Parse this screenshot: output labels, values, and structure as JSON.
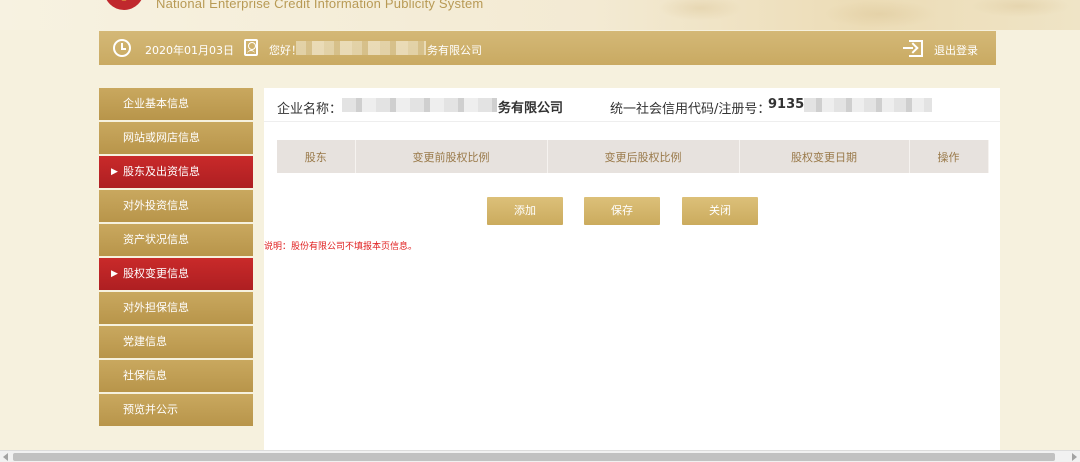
{
  "header": {
    "system_title": "National Enterprise Credit Information Publicity System"
  },
  "topbar": {
    "date": "2020年01月03日",
    "greeting": "您好！",
    "company_suffix": "务有限公司",
    "logout_label": "退出登录"
  },
  "sidebar": {
    "items": [
      {
        "label": "企业基本信息",
        "active": false
      },
      {
        "label": "网站或网店信息",
        "active": false
      },
      {
        "label": "股东及出资信息",
        "active": true
      },
      {
        "label": "对外投资信息",
        "active": false
      },
      {
        "label": "资产状况信息",
        "active": false
      },
      {
        "label": "股权变更信息",
        "active": true
      },
      {
        "label": "对外担保信息",
        "active": false
      },
      {
        "label": "党建信息",
        "active": false
      },
      {
        "label": "社保信息",
        "active": false
      },
      {
        "label": "预览并公示",
        "active": false
      }
    ],
    "active_marker": "▶"
  },
  "main": {
    "company_label": "企业名称：",
    "company_name_suffix": "务有限公司",
    "code_label": "统一社会信用代码/注册号：",
    "code_prefix": "9135",
    "table": {
      "columns": [
        "股东",
        "变更前股权比例",
        "变更后股权比例",
        "股权变更日期",
        "操作"
      ]
    },
    "buttons": {
      "add": "添加",
      "save": "保存",
      "close": "关闭"
    },
    "note": "说明：股份有限公司不填报本页信息。"
  },
  "colors": {
    "gold": "#c9a85f",
    "active_red": "#c92a2a",
    "note_red": "#e02020"
  }
}
